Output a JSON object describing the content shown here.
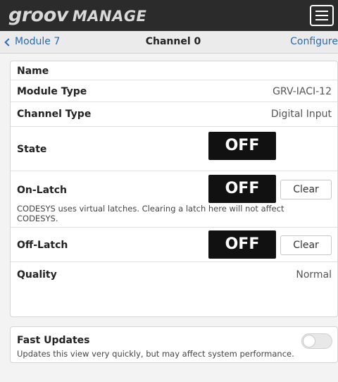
{
  "app": {
    "logo_part1": "groov",
    "logo_part2": "MANAGE"
  },
  "nav": {
    "back_label": "Module 7",
    "title": "Channel 0",
    "configure_label": "Configure"
  },
  "channel": {
    "name_label": "Name",
    "name_value": "",
    "module_type_label": "Module Type",
    "module_type_value": "GRV-IACI-12",
    "channel_type_label": "Channel Type",
    "channel_type_value": "Digital Input",
    "state_label": "State",
    "state_value": "OFF",
    "on_latch_label": "On-Latch",
    "on_latch_value": "OFF",
    "on_latch_clear": "Clear",
    "latch_note": "CODESYS uses virtual latches. Clearing a latch here will not affect CODESYS.",
    "off_latch_label": "Off-Latch",
    "off_latch_value": "OFF",
    "off_latch_clear": "Clear",
    "quality_label": "Quality",
    "quality_value": "Normal"
  },
  "fast_updates": {
    "title": "Fast Updates",
    "description": "Updates this view very quickly, but may affect system performance.",
    "enabled": false
  },
  "icons": {
    "menu": "hamburger-menu-icon",
    "back": "chevron-left-icon"
  }
}
